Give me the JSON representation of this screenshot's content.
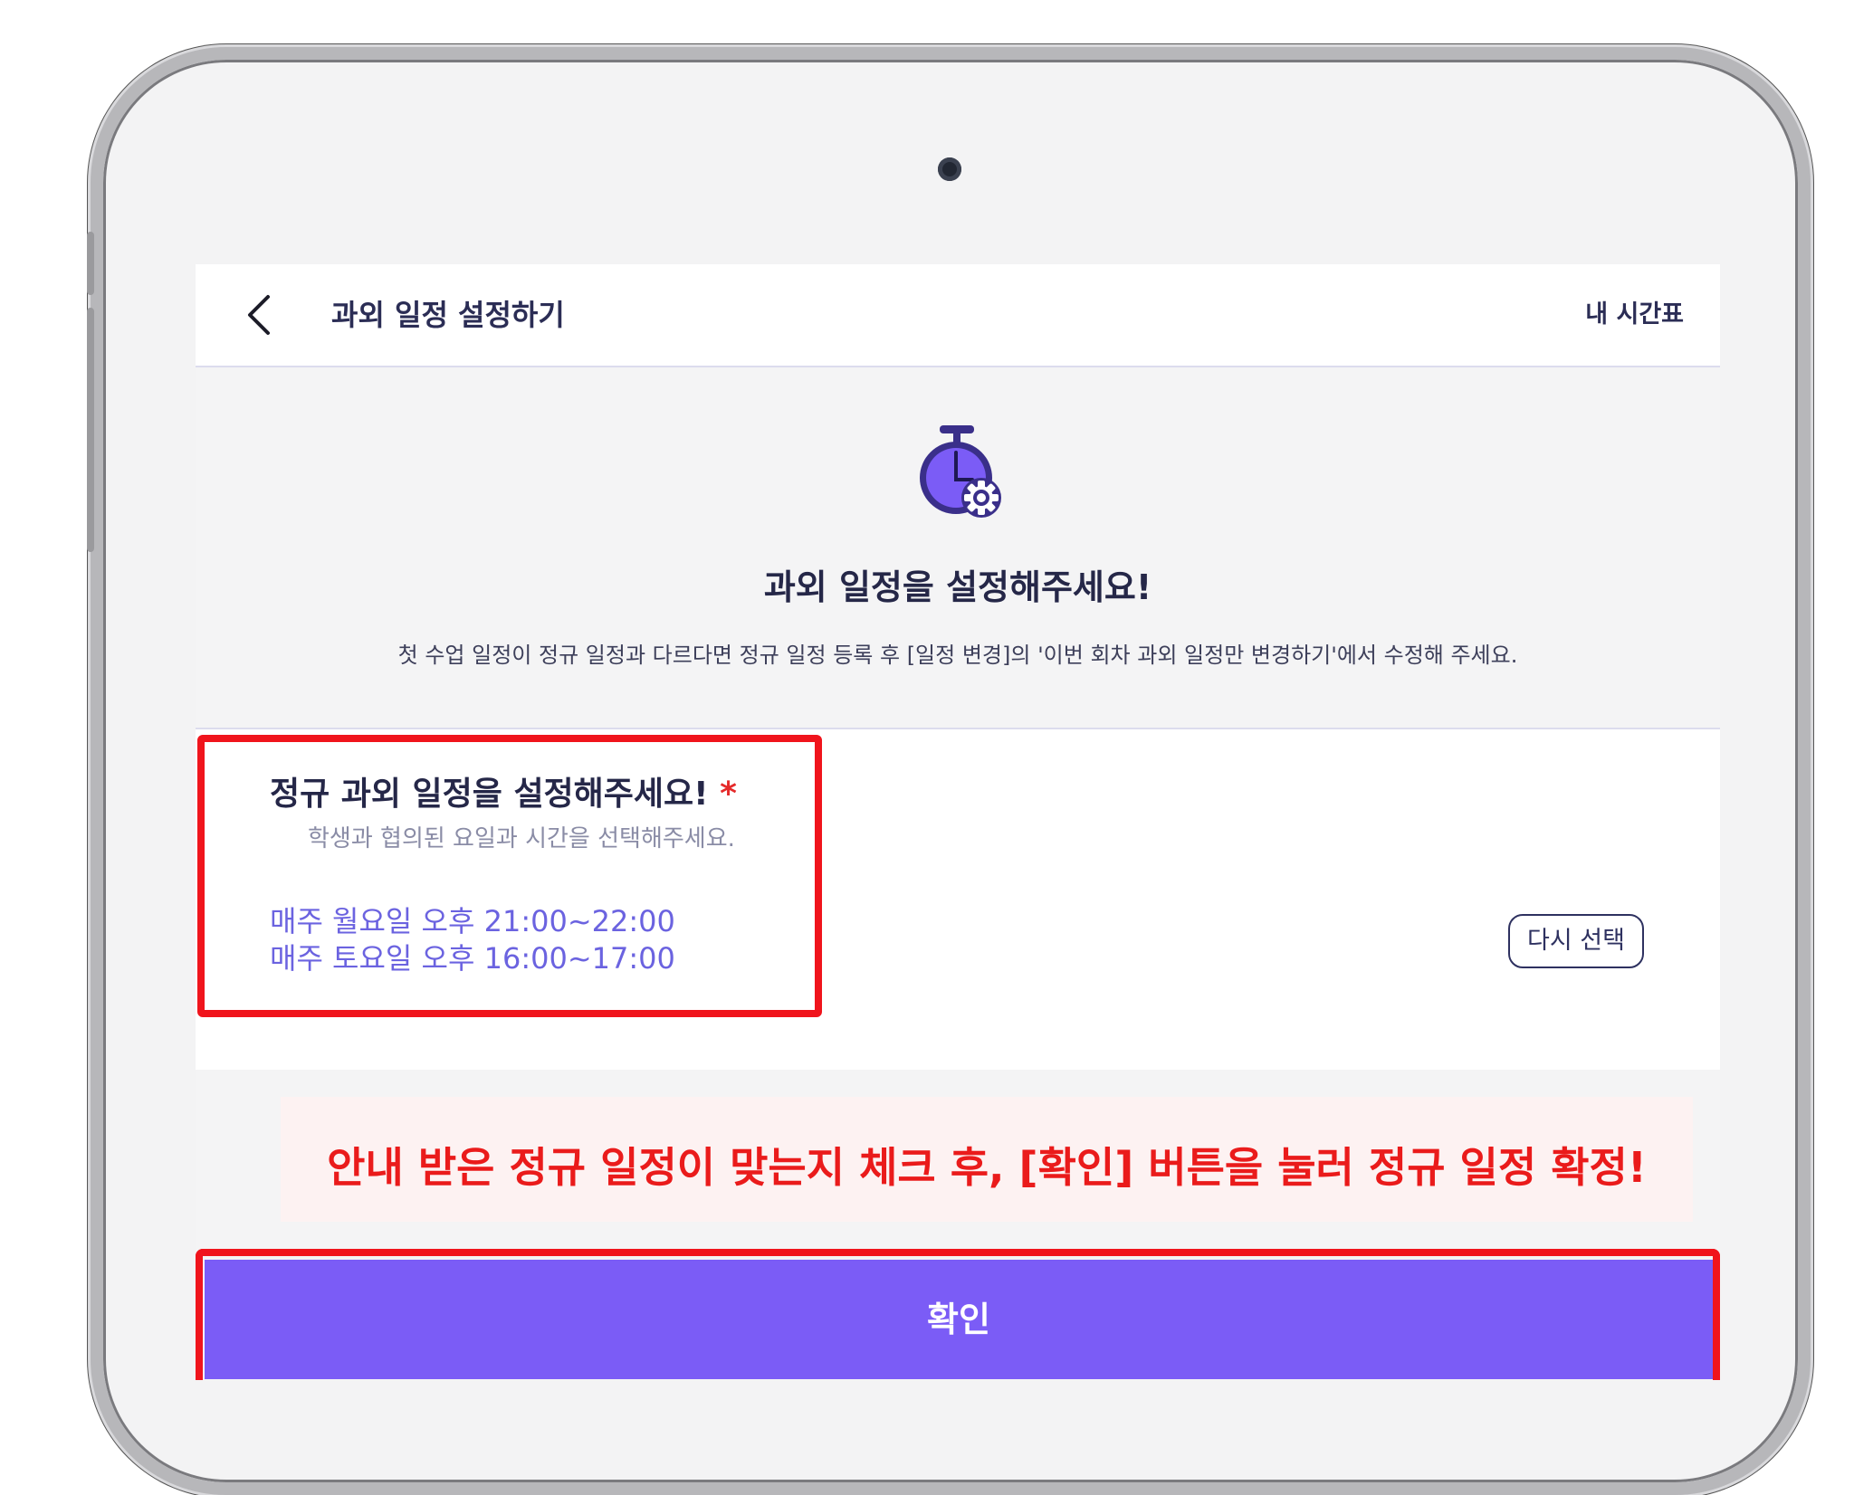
{
  "header": {
    "title": "과외 일정 설정하기",
    "timetable_link": "내 시간표"
  },
  "hero": {
    "title": "과외 일정을 설정해주세요!",
    "description": "첫 수업 일정이 정규 일정과 다르다면 정규 일정 등록 후 [일정 변경]의 '이번 회차 과외 일정만 변경하기'에서 수정해 주세요."
  },
  "schedule_card": {
    "title": "정규 과외 일정을 설정해주세요!",
    "required_mark": "*",
    "subtitle": "학생과 협의된 요일과 시간을 선택해주세요.",
    "items": [
      "매주 월요일 오후 21:00~22:00",
      "매주 토요일 오후 16:00~17:00"
    ],
    "reselect_label": "다시 선택"
  },
  "notice": {
    "text": "안내 받은 정규 일정이 맞는지 체크 후, [확인] 버튼을 눌러 정규 일정 확정!"
  },
  "confirm_label": "확인",
  "colors": {
    "accent": "#7b5cf6",
    "highlight": "#f0141c",
    "schedule_text": "#6b63e0",
    "title_text": "#252748"
  },
  "icons": {
    "back": "chevron-left-icon",
    "hero": "stopwatch-gear-icon"
  }
}
